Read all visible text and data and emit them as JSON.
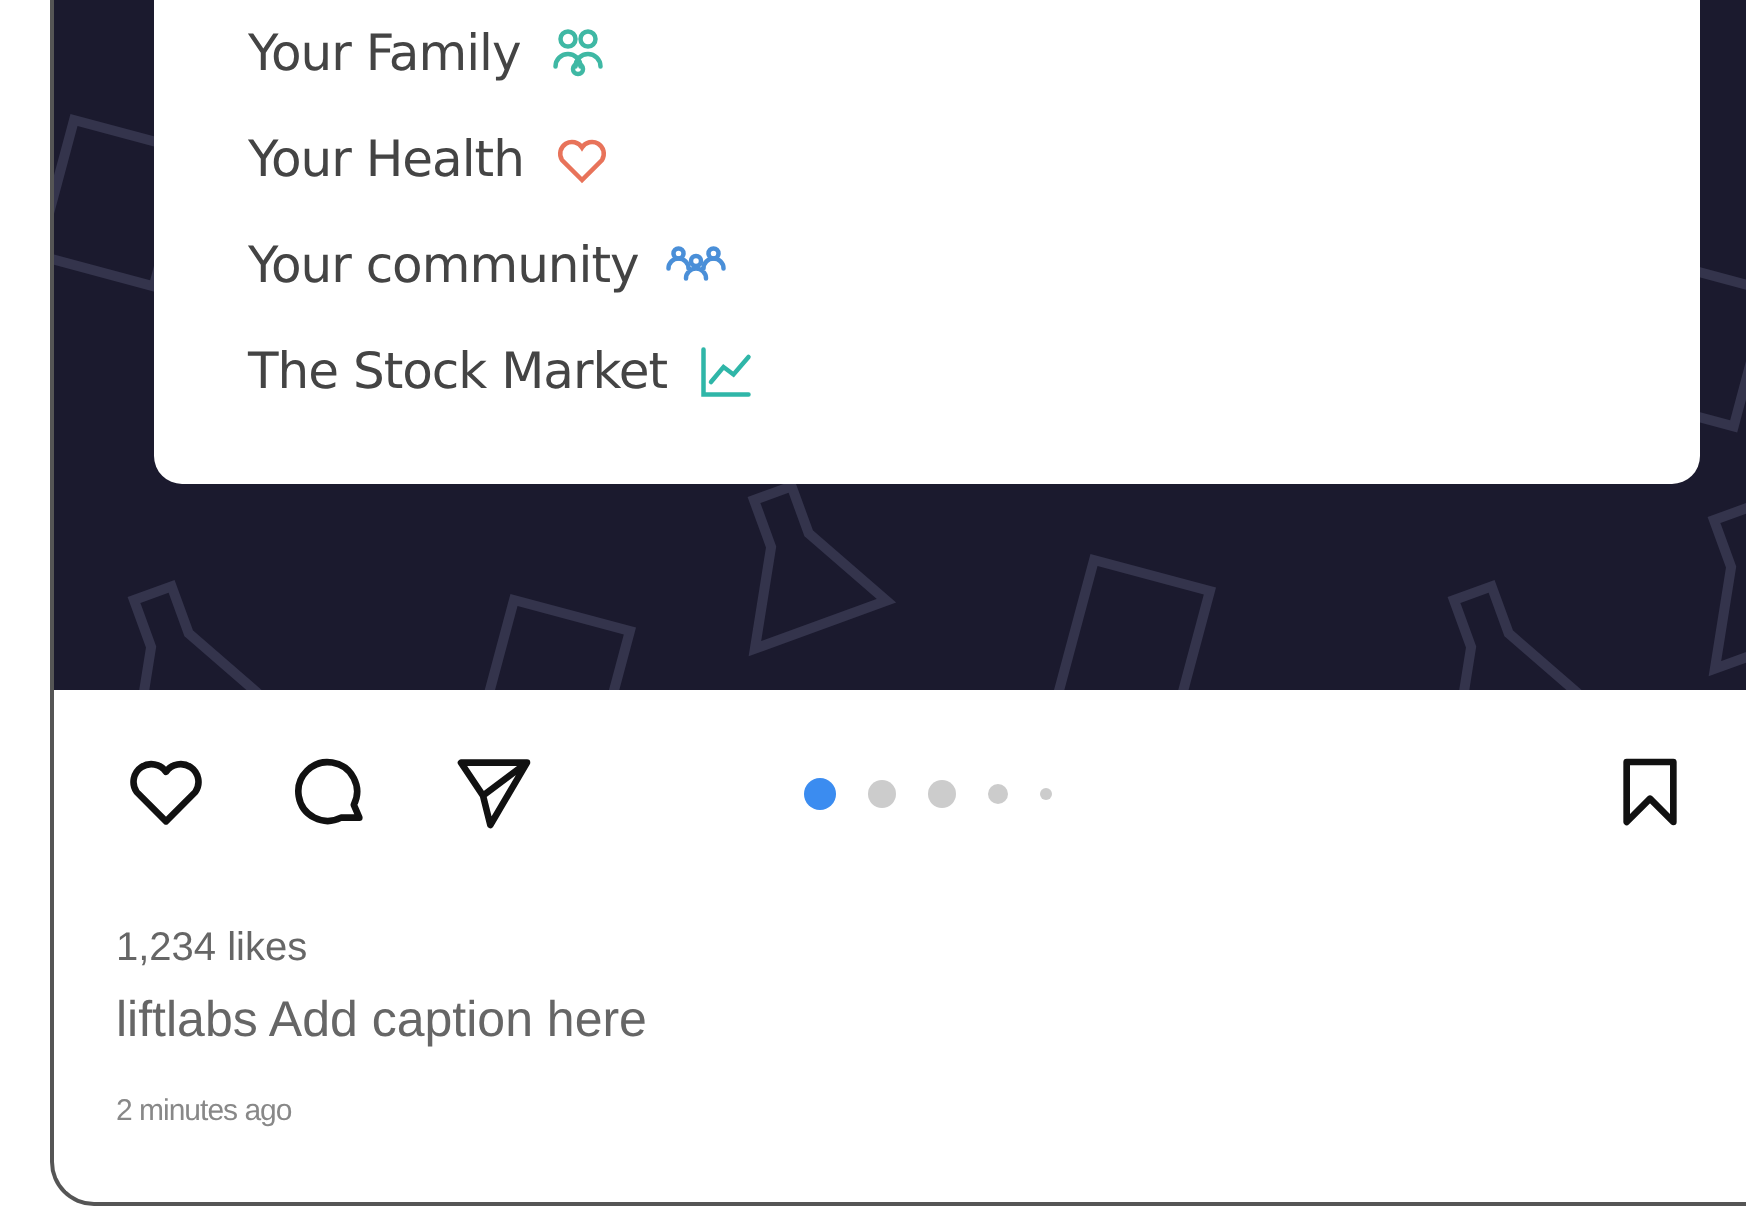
{
  "post_image": {
    "items": [
      {
        "label": "Your Family",
        "kind": "family",
        "color": "#3fb8a4"
      },
      {
        "label": "Your Health",
        "kind": "health",
        "color": "#e8735a"
      },
      {
        "label": "Your community",
        "kind": "community",
        "color": "#4a8fd8"
      },
      {
        "label": "The Stock Market",
        "kind": "chart",
        "color": "#2fb6a8"
      }
    ]
  },
  "actions": [
    {
      "kind": "like"
    },
    {
      "kind": "comment"
    },
    {
      "kind": "share"
    }
  ],
  "carousel": [
    {
      "selected": true
    },
    {
      "selected": false
    },
    {
      "selected": false
    },
    {
      "selected": false
    },
    {
      "selected": false
    }
  ],
  "bookmark": {
    "saved": false
  },
  "likes": "1,234 likes",
  "caption": "liftlabs Add caption here",
  "time": "2 minutes ago"
}
